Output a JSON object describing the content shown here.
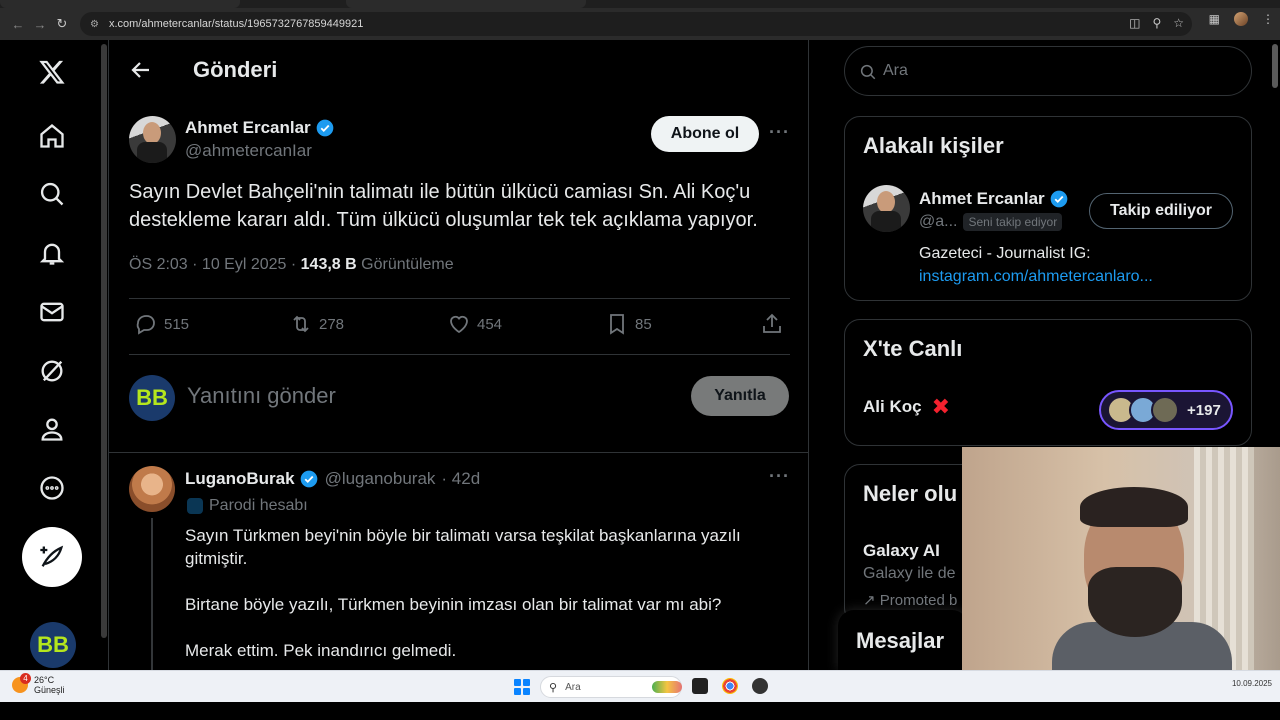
{
  "browser": {
    "url": "x.com/ahmetercanlar/status/1965732767859449921"
  },
  "header": {
    "title": "Gönderi"
  },
  "post": {
    "author_name": "Ahmet Ercanlar",
    "author_handle": "@ahmetercanIar",
    "follow_label": "Abone ol",
    "text": "Sayın Devlet Bahçeli'nin talimatı ile bütün ülkücü camiası Sn. Ali Koç'u destekleme kararı aldı. Tüm ülkücü oluşumlar tek tek açıklama yapıyor.",
    "time": "ÖS 2:03 · 10 Eyl 2025 ·",
    "views_count": "143,8 B",
    "views_label": "Görüntüleme",
    "replies": "515",
    "reposts": "278",
    "likes": "454",
    "bookmarks": "85"
  },
  "compose": {
    "placeholder": "Yanıtını gönder",
    "reply_label": "Yanıtla",
    "avatar_text": "BB"
  },
  "comment": {
    "name": "LuganoBurak",
    "handle": "@luganoburak",
    "age": "· 42d",
    "parody": "Parodi hesabı",
    "lines": [
      "Sayın Türkmen beyi'nin böyle bir talimatı varsa teşkilat başkanlarına yazılı gitmiştir.",
      "Birtane böyle yazılı, Türkmen beyinin imzası olan bir talimat var mı abi?",
      "Merak ettim. Pek inandırıcı gelmedi."
    ]
  },
  "sidebar": {
    "search_placeholder": "Ara",
    "related": {
      "title": "Alakalı kişiler",
      "name": "Ahmet Ercanlar",
      "handle": "@a...",
      "follows_you": "Seni takip ediyor",
      "following_label": "Takip ediliyor",
      "bio": "Gazeteci - Journalist IG:",
      "link": "instagram.com/ahmetercanlaro..."
    },
    "live": {
      "title": "X'te Canlı",
      "name": "Ali Koç",
      "count": "+197"
    },
    "trends": {
      "title": "Neler olu",
      "name": "Galaxy AI",
      "desc": "Galaxy ile de",
      "promo": "Promoted b"
    },
    "messages_label": "Mesajlar"
  },
  "taskbar": {
    "temp": "26°C",
    "weather": "Güneşli",
    "badge": "4",
    "search": "Ara",
    "date": "10.09.2025"
  },
  "colors": {
    "accent": "#1d9bf0",
    "live_border": "#7856ff",
    "nav_avatar_text": "#b5e61d"
  }
}
